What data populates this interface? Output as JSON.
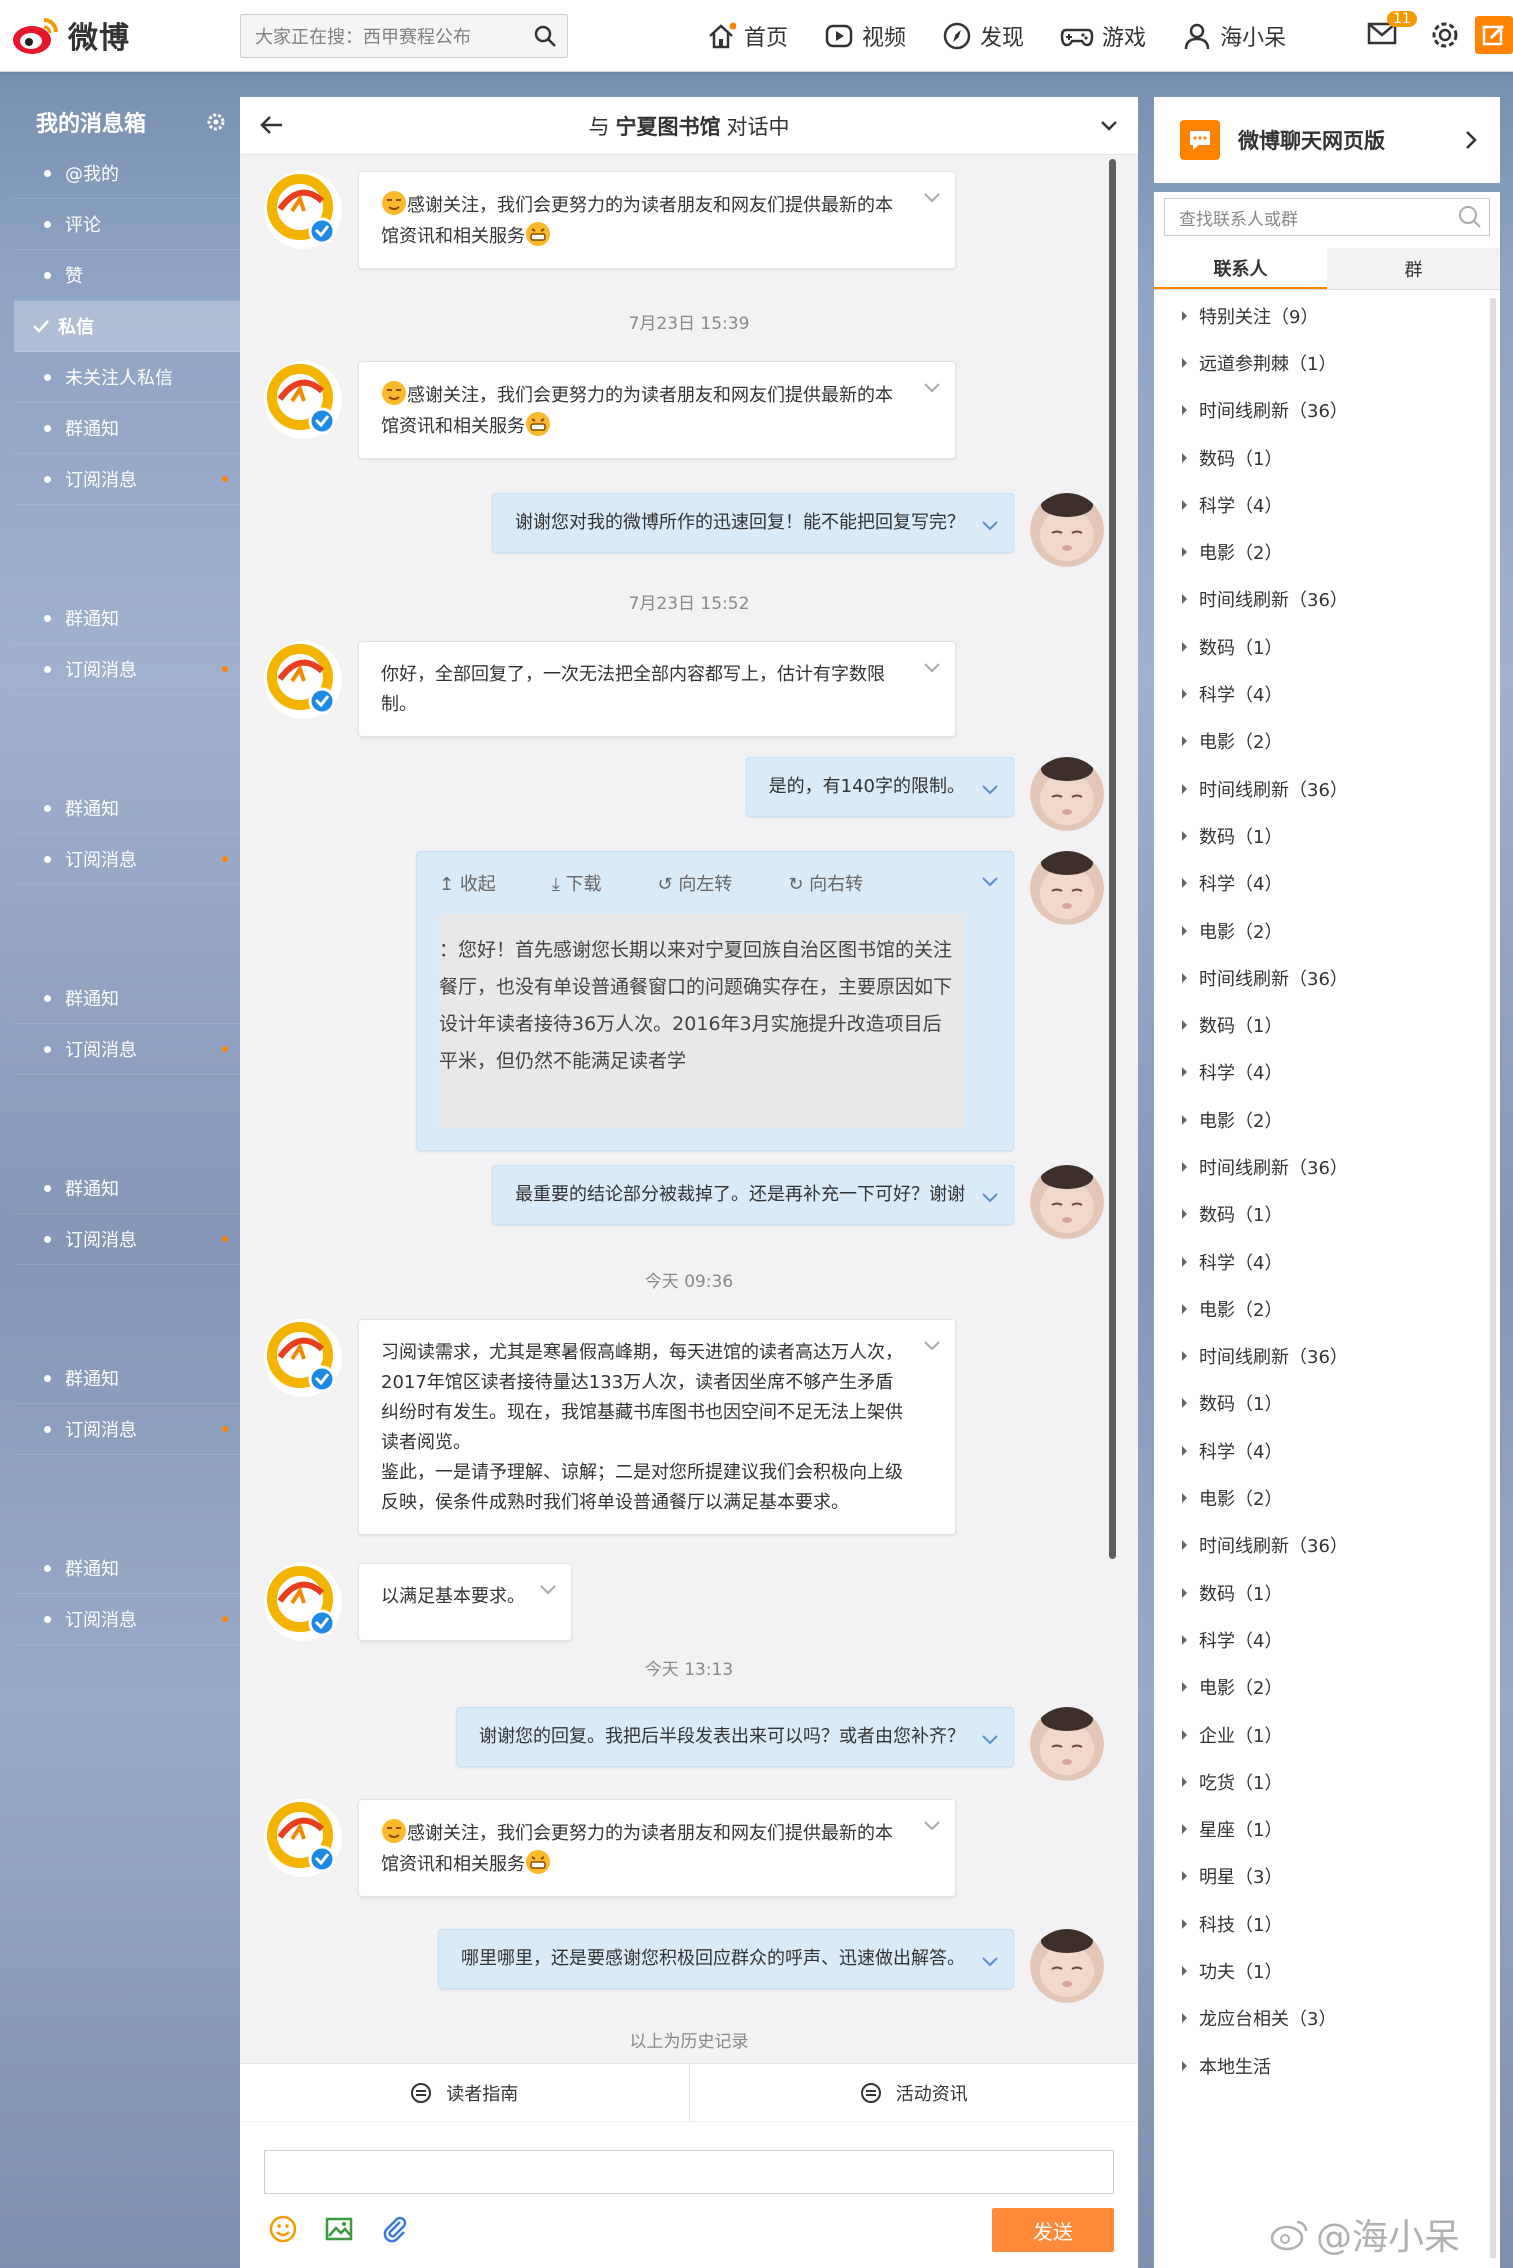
{
  "header": {
    "logo_text": "微博",
    "search_placeholder": "大家正在搜：西甲赛程公布",
    "nav": [
      {
        "label": "首页",
        "icon": "home-icon"
      },
      {
        "label": "视频",
        "icon": "video-icon"
      },
      {
        "label": "发现",
        "icon": "compass-icon"
      },
      {
        "label": "游戏",
        "icon": "gamepad-icon"
      },
      {
        "label": "海小呆",
        "icon": "user-icon"
      }
    ],
    "mail_badge": "11",
    "accent": "#ff8200"
  },
  "sidebar": {
    "title": "我的消息箱",
    "items": [
      {
        "label": "@我的"
      },
      {
        "label": "评论"
      },
      {
        "label": "赞"
      },
      {
        "label": "私信"
      },
      {
        "label": "未关注人私信"
      },
      {
        "label": "群通知"
      },
      {
        "label": "订阅消息"
      }
    ],
    "repeat_group": [
      "群通知",
      "订阅消息"
    ]
  },
  "chat": {
    "prefix": "与",
    "partner": "宁夏图书馆",
    "suffix": "对话中",
    "messages": {
      "m1": "感谢关注，我们会更努力的为读者朋友和网友们提供最新的本馆资讯和相关服务",
      "t1": "7月23日 15:39",
      "m2": "感谢关注，我们会更努力的为读者朋友和网友们提供最新的本馆资讯和相关服务",
      "m3": "谢谢您对我的微博所作的迅速回复！能不能把回复写完？",
      "t2": "7月23日 15:52",
      "m4": "你好，全部回复了，一次无法把全部内容都写上，估计有字数限制。",
      "m5": "是的，有140字的限制。",
      "img_tools": [
        "收起",
        "下载",
        "向左转",
        "向右转"
      ],
      "img_lines": [
        "：您好！首先感谢您长期以来对宁夏回族自治区图书馆的关注",
        "餐厅，也没有单设普通餐窗口的问题确实存在，主要原因如下",
        "设计年读者接待36万人次。2016年3月实施提升改造项目后",
        "平米，但仍然不能满足读者学"
      ],
      "m6": "最重要的结论部分被裁掉了。还是再补充一下可好？谢谢",
      "t3": "今天 09:36",
      "m7": "习阅读需求，尤其是寒暑假高峰期，每天进馆的读者高达万人次，2017年馆区读者接待量达133万人次，读者因坐席不够产生矛盾纠纷时有发生。现在，我馆基藏书库图书也因空间不足无法上架供读者阅览。",
      "m7b": "鉴此，一是请予理解、谅解；二是对您所提建议我们会积极向上级反映，侯条件成熟时我们将单设普通餐厅以满足基本要求。",
      "m8": "以满足基本要求。",
      "t4": "今天 13:13",
      "m9": "谢谢您的回复。我把后半段发表出来可以吗？或者由您补齐？",
      "m10": "感谢关注，我们会更努力的为读者朋友和网友们提供最新的本馆资讯和相关服务",
      "m11": "哪里哪里，还是要感谢您积极回应群众的呼声、迅速做出解答。",
      "history": "以上为历史记录"
    },
    "menu": [
      "读者指南",
      "活动资讯"
    ],
    "send_label": "发送"
  },
  "right": {
    "title": "微博聊天网页版",
    "search_placeholder": "查找联系人或群",
    "tabs": [
      "联系人",
      "群"
    ],
    "contacts": [
      "特别关注（9）",
      "远道参荆棘（1）",
      "时间线刷新（36）",
      "数码（1）",
      "科学（4）",
      "电影（2）",
      "时间线刷新（36）",
      "数码（1）",
      "科学（4）",
      "电影（2）",
      "时间线刷新（36）",
      "数码（1）",
      "科学（4）",
      "电影（2）",
      "时间线刷新（36）",
      "数码（1）",
      "科学（4）",
      "电影（2）",
      "时间线刷新（36）",
      "数码（1）",
      "科学（4）",
      "电影（2）",
      "时间线刷新（36）",
      "数码（1）",
      "科学（4）",
      "电影（2）",
      "时间线刷新（36）",
      "数码（1）",
      "科学（4）",
      "电影（2）",
      "企业（1）",
      "吃货（1）",
      "星座（1）",
      "明星（3）",
      "科技（1）",
      "功夫（1）",
      "龙应台相关（3）",
      "本地生活"
    ]
  },
  "watermark": "@海小呆"
}
